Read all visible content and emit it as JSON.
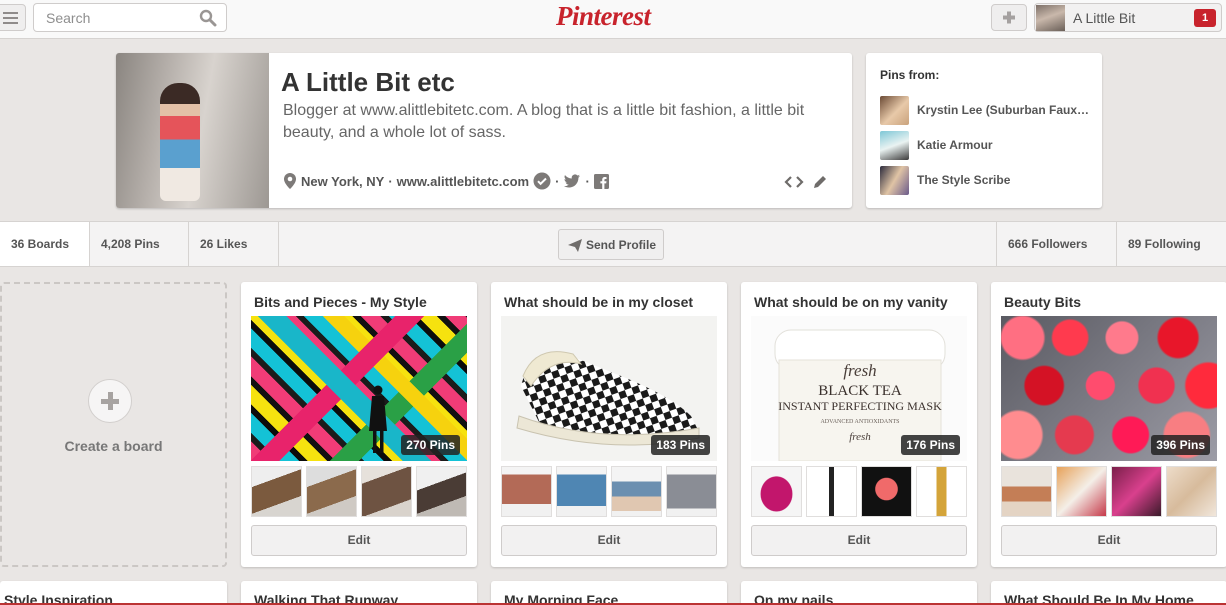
{
  "header": {
    "search_placeholder": "Search",
    "logo": "Pinterest",
    "user_name": "A Little Bit",
    "notification_count": "1",
    "brand_color": "#c8232c"
  },
  "profile": {
    "name": "A Little Bit etc",
    "bio": "Blogger at www.alittlebitetc.com. A blog that is a little bit fashion, a little bit beauty, and a whole lot of sass.",
    "location": "New York, NY",
    "separator": "·",
    "website": "www.alittlebitetc.com",
    "icons": [
      "location-pin-icon",
      "verified-check-icon",
      "twitter-icon",
      "facebook-icon",
      "embed-code-icon",
      "edit-pencil-icon"
    ]
  },
  "pins_from": {
    "title": "Pins from:",
    "items": [
      {
        "name": "Krystin Lee (Suburban Faux…"
      },
      {
        "name": "Katie Armour"
      },
      {
        "name": "The Style Scribe"
      }
    ]
  },
  "stats": {
    "boards": "36 Boards",
    "pins": "4,208 Pins",
    "likes": "26 Likes",
    "send_profile": "Send Profile",
    "followers": "666 Followers",
    "following": "89 Following"
  },
  "create_board": {
    "label": "Create a board"
  },
  "boards": [
    {
      "title": "Bits and Pieces - My Style",
      "pin_count": "270 Pins",
      "edit": "Edit"
    },
    {
      "title": "What should be in my closet",
      "pin_count": "183 Pins",
      "edit": "Edit"
    },
    {
      "title": "What should be on my vanity",
      "pin_count": "176 Pins",
      "edit": "Edit"
    },
    {
      "title": "Beauty Bits",
      "pin_count": "396 Pins",
      "edit": "Edit"
    }
  ],
  "boards_row2": [
    {
      "title": "Style Inspiration"
    },
    {
      "title": "Walking That Runway"
    },
    {
      "title": "My Morning Face"
    },
    {
      "title": "On my nails"
    },
    {
      "title": "What Should Be In My Home"
    }
  ],
  "cover_text": {
    "jar_brand": "fresh",
    "jar_line1": "BLACK TEA",
    "jar_line2": "INSTANT PERFECTING MASK",
    "jar_line3": "ADVANCED ANTIOXIDANTS",
    "jar_line4": "fresh"
  }
}
